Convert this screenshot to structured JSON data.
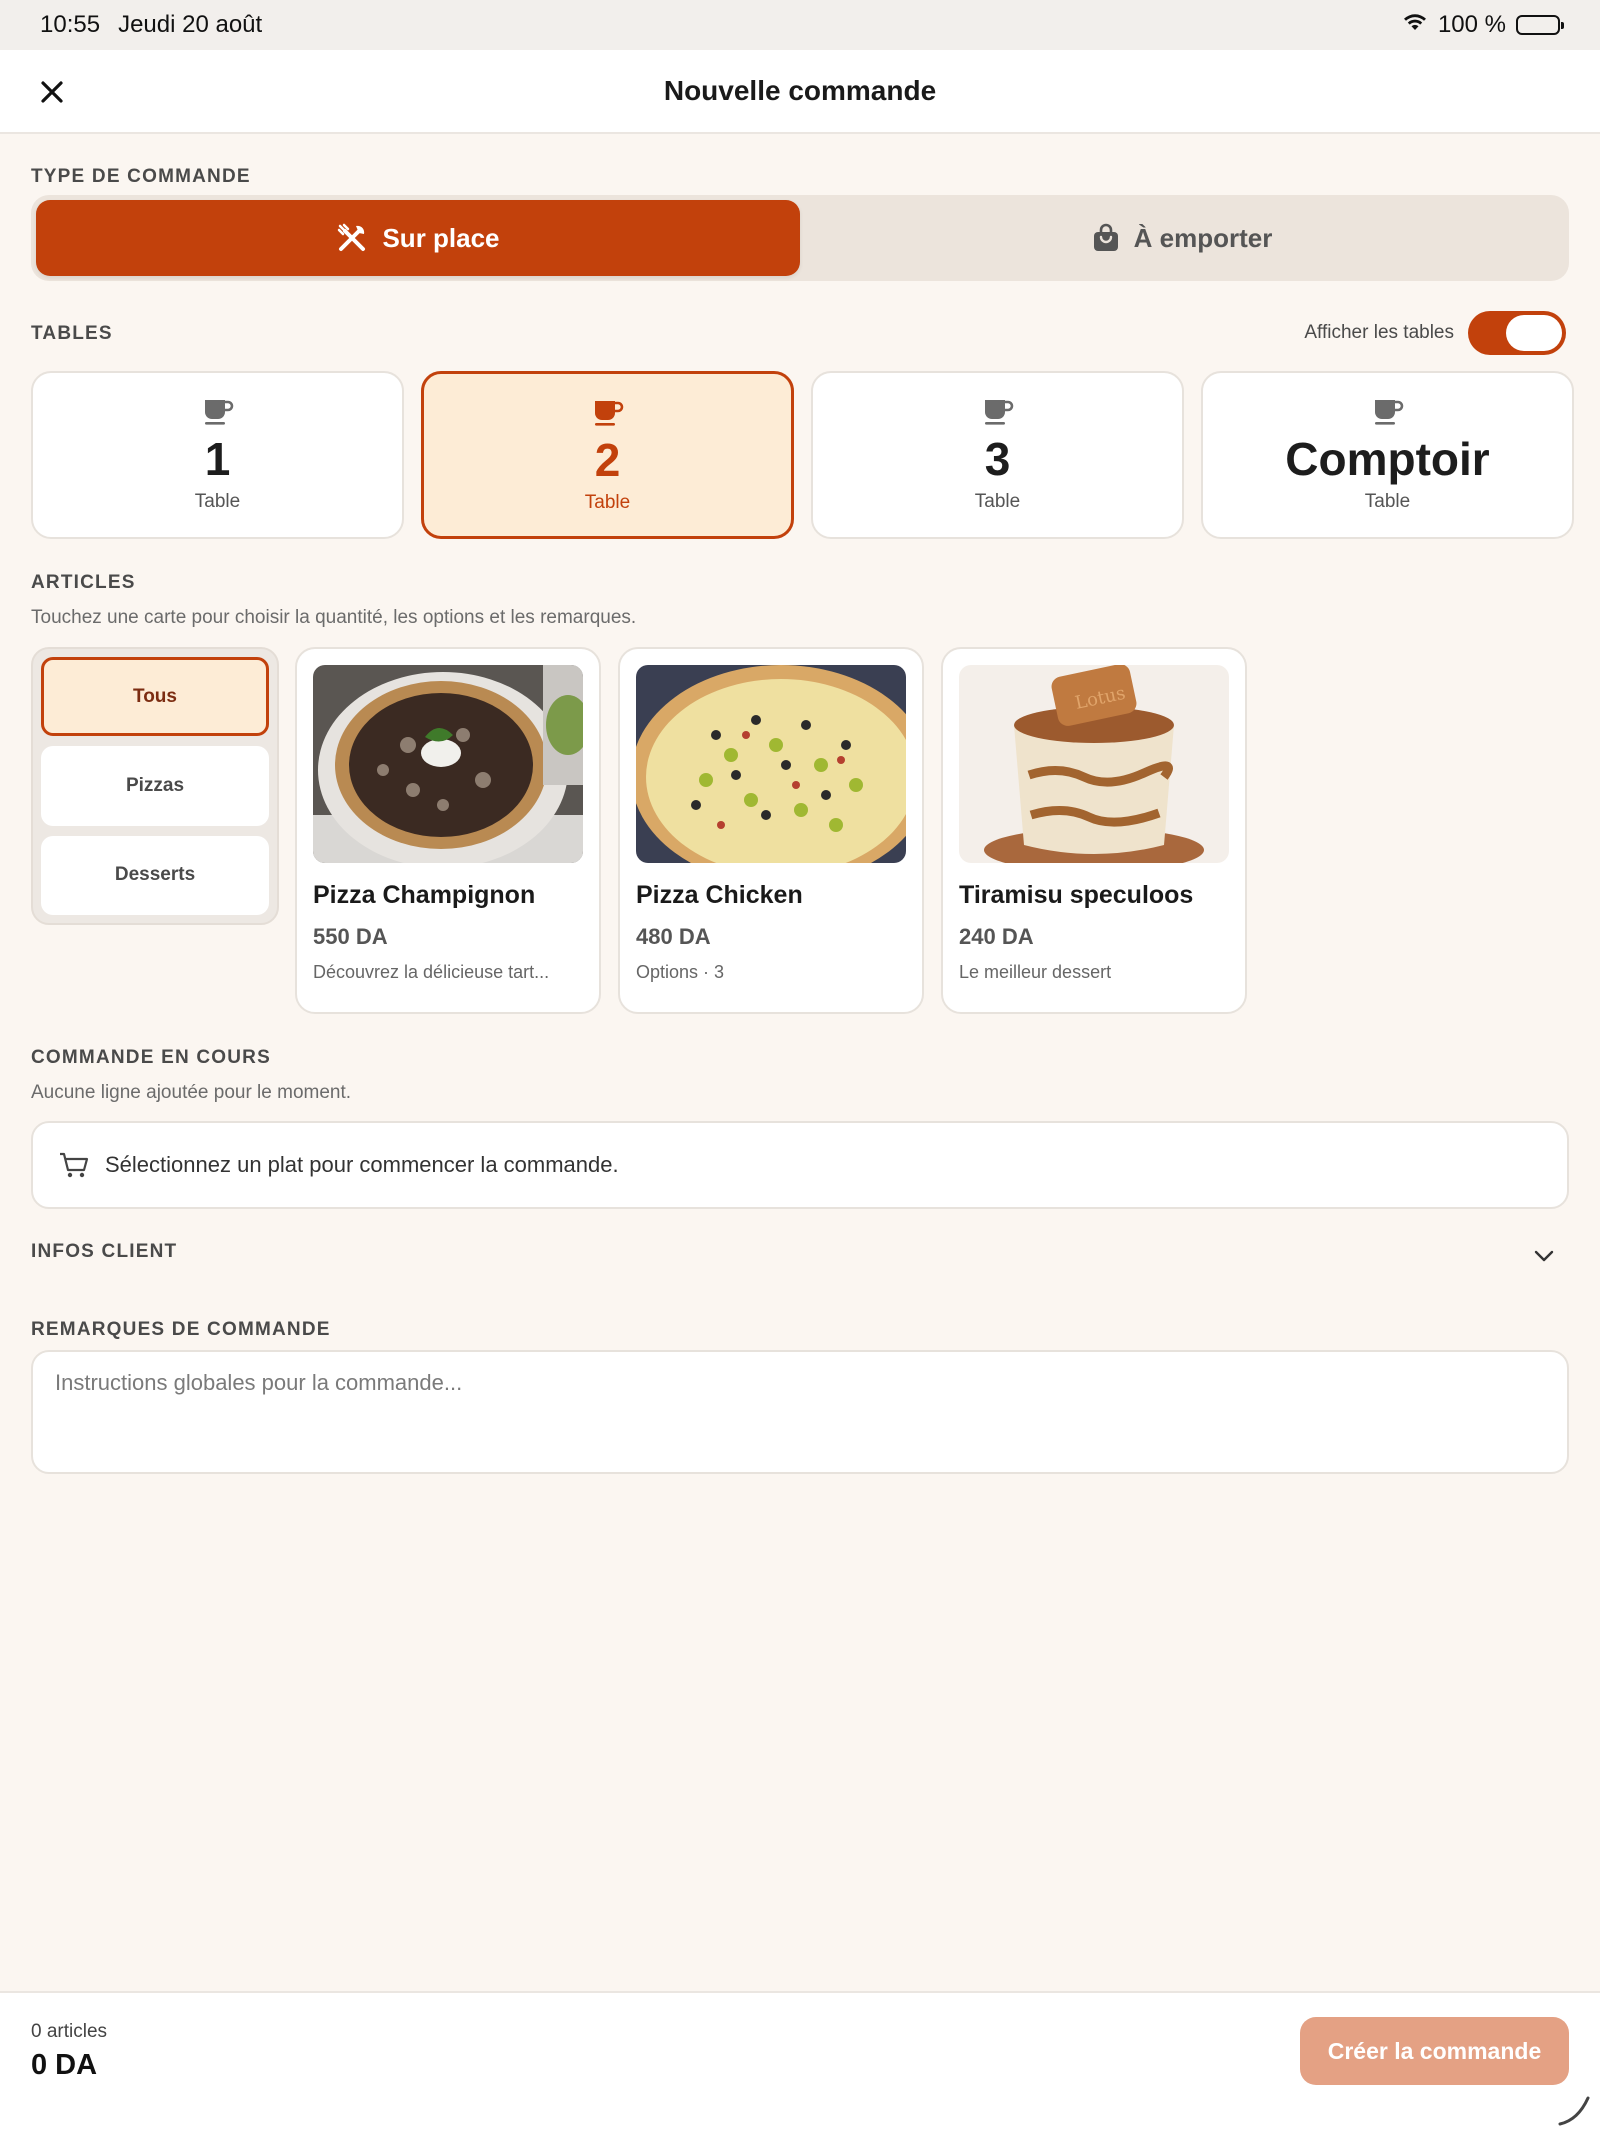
{
  "status_bar": {
    "time": "10:55",
    "date": "Jeudi 20 août",
    "battery": "100 %"
  },
  "header": {
    "title": "Nouvelle commande"
  },
  "order_type": {
    "label": "TYPE DE COMMANDE",
    "options": [
      {
        "label": "Sur place",
        "icon": "utensils-icon",
        "selected": true
      },
      {
        "label": "À emporter",
        "icon": "shopping-bag-icon",
        "selected": false
      }
    ]
  },
  "tables": {
    "label": "TABLES",
    "toggle_label": "Afficher les tables",
    "toggle_on": true,
    "items": [
      {
        "name": "1",
        "sub": "Table",
        "selected": false
      },
      {
        "name": "2",
        "sub": "Table",
        "selected": true
      },
      {
        "name": "3",
        "sub": "Table",
        "selected": false
      },
      {
        "name": "Comptoir",
        "sub": "Table",
        "selected": false
      }
    ]
  },
  "articles": {
    "label": "ARTICLES",
    "hint": "Touchez une carte pour choisir la quantité, les options et les remarques.",
    "categories": [
      {
        "label": "Tous",
        "active": true
      },
      {
        "label": "Pizzas",
        "active": false
      },
      {
        "label": "Desserts",
        "active": false
      }
    ],
    "products": [
      {
        "name": "Pizza Champignon",
        "price": "550 DA",
        "desc": "Découvrez la délicieuse tart..."
      },
      {
        "name": "Pizza Chicken",
        "price": "480 DA",
        "desc": "Options · 3"
      },
      {
        "name": "Tiramisu speculoos",
        "price": "240 DA",
        "desc": "Le meilleur dessert"
      }
    ]
  },
  "current_order": {
    "label": "COMMANDE EN COURS",
    "hint": "Aucune ligne ajoutée pour le moment.",
    "empty_message": "Sélectionnez un plat pour commencer la commande."
  },
  "client_info": {
    "label": "INFOS CLIENT"
  },
  "remarks": {
    "label": "REMARQUES DE COMMANDE",
    "placeholder": "Instructions globales pour la commande...",
    "value": ""
  },
  "footer": {
    "count": "0 articles",
    "total": "0 DA",
    "create_label": "Créer la commande"
  },
  "colors": {
    "accent": "#c2410c",
    "accent_light": "#fdecd6",
    "background": "#fbf6f1",
    "button_disabled": "#e4a184"
  }
}
